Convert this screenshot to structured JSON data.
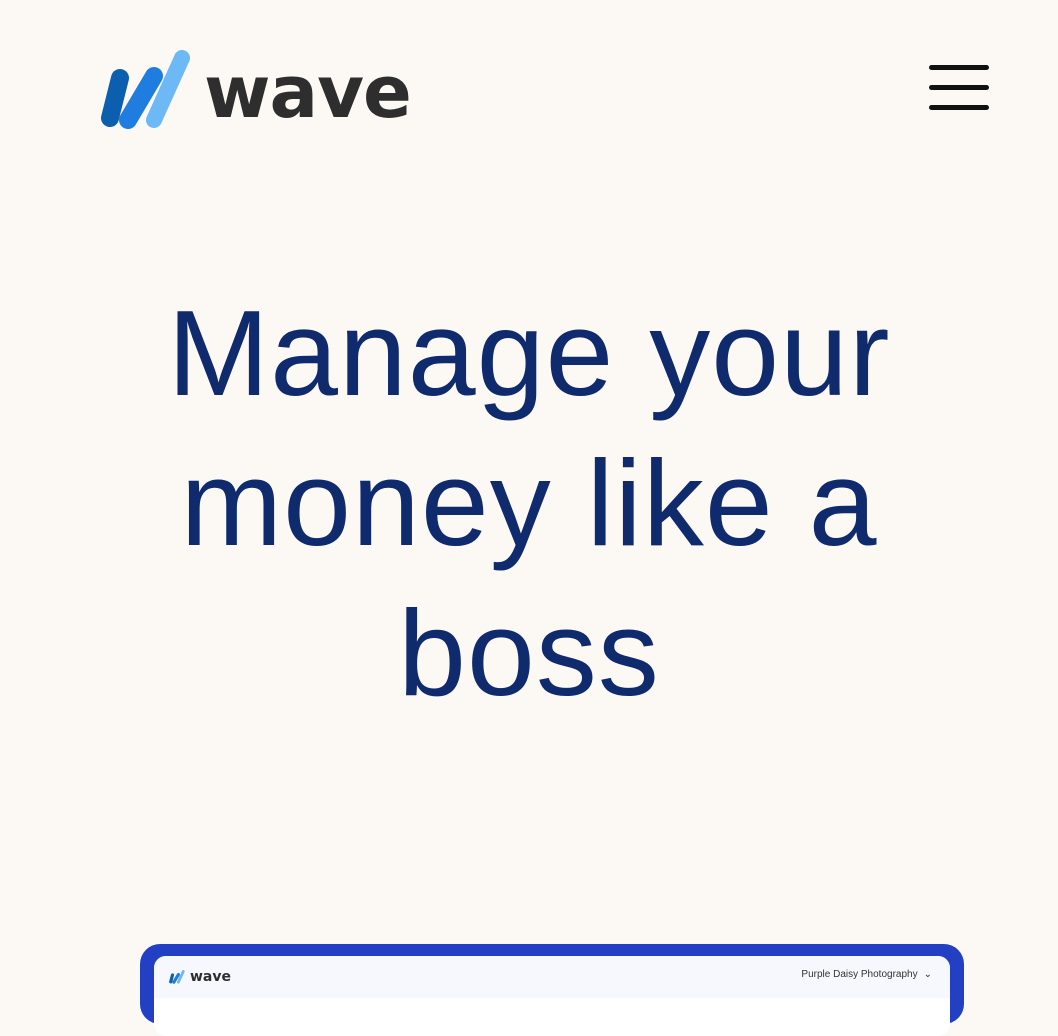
{
  "brand": {
    "name": "wave",
    "colors": {
      "mark_dark": "#0b5fae",
      "mark_mid": "#1f7de0",
      "mark_light": "#6cb9f5",
      "wordmark": "#2e2e2e"
    }
  },
  "header": {
    "menu_icon": "hamburger-menu-icon"
  },
  "hero": {
    "title": "Manage your money like a boss",
    "title_color": "#102a6e"
  },
  "preview": {
    "frame_color": "#2340c4",
    "logo_text": "wave",
    "business_name": "Purple Daisy Photography",
    "chevron_icon": "chevron-down-icon"
  },
  "page": {
    "background": "#fcf9f5"
  }
}
